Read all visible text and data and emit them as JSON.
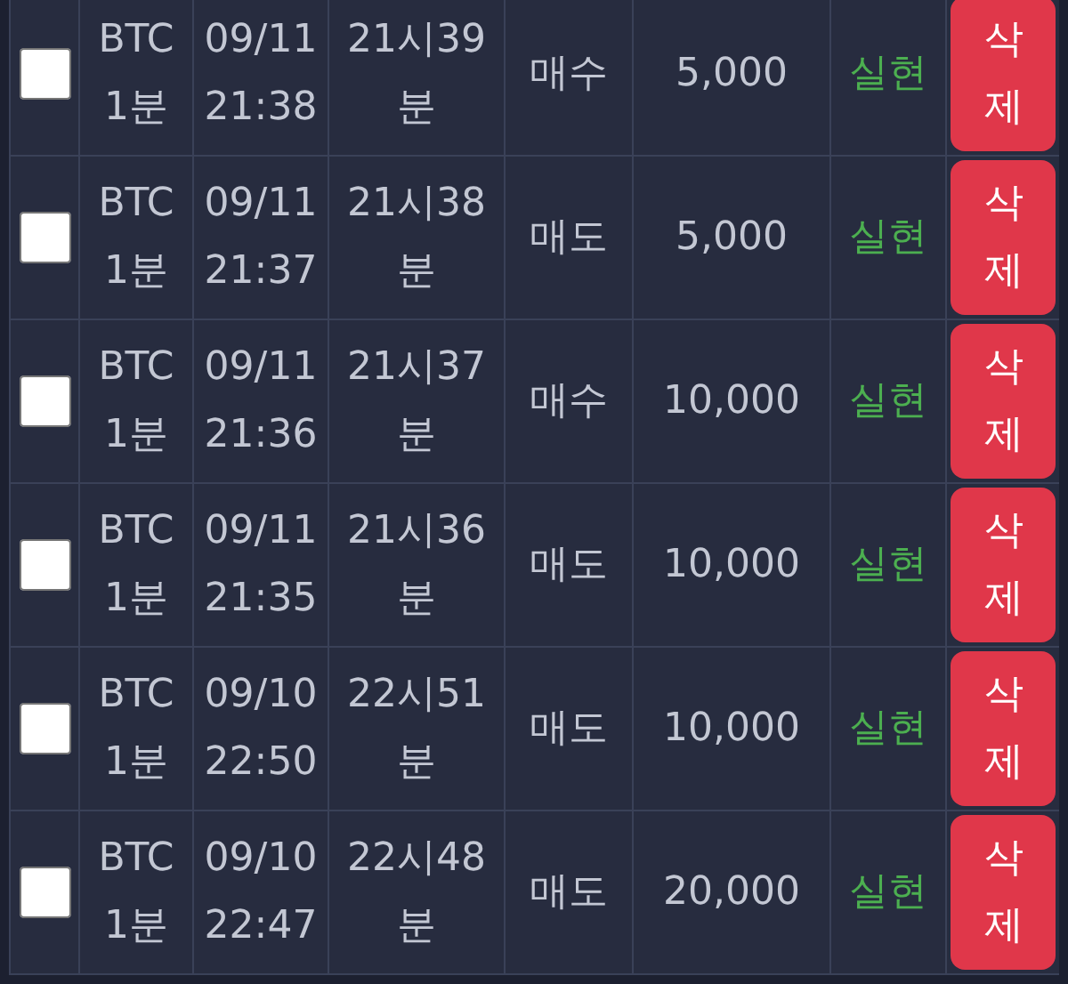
{
  "orders": [
    {
      "checked": false,
      "symbol": "BTC",
      "interval": "1분",
      "date": "09/11",
      "time": "21:38",
      "round_hour": "21시39",
      "round_min": "분",
      "side": "매수",
      "amount": "5,000",
      "status": "실현",
      "kind": "realized",
      "action": "삭제"
    },
    {
      "checked": false,
      "symbol": "BTC",
      "interval": "1분",
      "date": "09/11",
      "time": "21:37",
      "round_hour": "21시38",
      "round_min": "분",
      "side": "매도",
      "amount": "5,000",
      "status": "실현",
      "kind": "realized",
      "action": "삭제"
    },
    {
      "checked": false,
      "symbol": "BTC",
      "interval": "1분",
      "date": "09/11",
      "time": "21:36",
      "round_hour": "21시37",
      "round_min": "분",
      "side": "매수",
      "amount": "10,000",
      "status": "실현",
      "kind": "realized",
      "action": "삭제"
    },
    {
      "checked": false,
      "symbol": "BTC",
      "interval": "1분",
      "date": "09/11",
      "time": "21:35",
      "round_hour": "21시36",
      "round_min": "분",
      "side": "매도",
      "amount": "10,000",
      "status": "실현",
      "kind": "realized",
      "action": "삭제"
    },
    {
      "checked": false,
      "symbol": "BTC",
      "interval": "1분",
      "date": "09/10",
      "time": "22:50",
      "round_hour": "22시51",
      "round_min": "분",
      "side": "매도",
      "amount": "10,000",
      "status": "실현",
      "kind": "realized",
      "action": "삭제"
    },
    {
      "checked": false,
      "symbol": "BTC",
      "interval": "1분",
      "date": "09/10",
      "time": "22:47",
      "round_hour": "22시48",
      "round_min": "분",
      "side": "매도",
      "amount": "20,000",
      "status": "실현",
      "kind": "realized",
      "action": "삭제"
    }
  ]
}
